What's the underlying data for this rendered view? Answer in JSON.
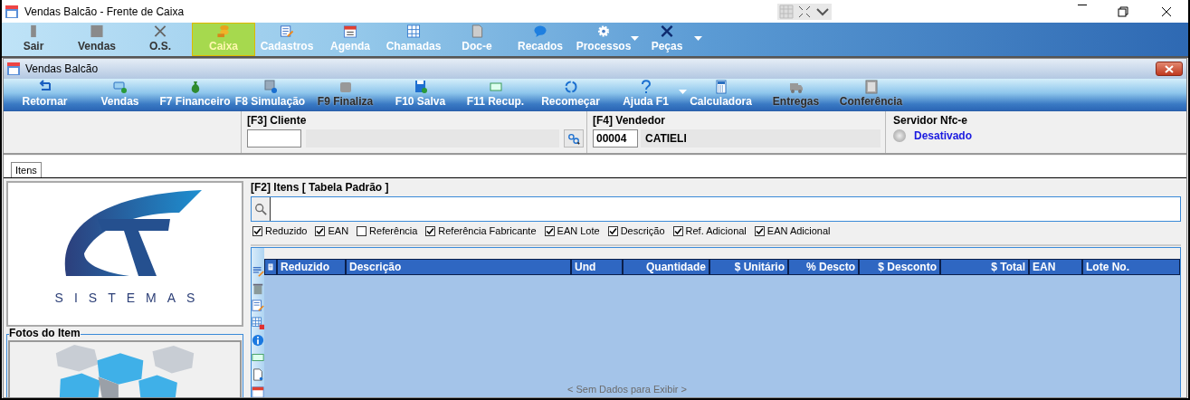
{
  "window": {
    "title": "Vendas Balcão - Frente de Caixa"
  },
  "main_menu": [
    {
      "label": "Sair",
      "selected": false,
      "has_menu": false
    },
    {
      "label": "Vendas",
      "selected": false,
      "has_menu": false
    },
    {
      "label": "O.S.",
      "selected": false,
      "has_menu": false
    },
    {
      "label": "Caixa",
      "selected": true,
      "has_menu": false
    },
    {
      "label": "Cadastros",
      "selected": false,
      "has_menu": false
    },
    {
      "label": "Agenda",
      "selected": false,
      "has_menu": false
    },
    {
      "label": "Chamadas",
      "selected": false,
      "has_menu": false
    },
    {
      "label": "Doc-e",
      "selected": false,
      "has_menu": false
    },
    {
      "label": "Recados",
      "selected": false,
      "has_menu": false
    },
    {
      "label": "Processos",
      "selected": false,
      "has_menu": true
    },
    {
      "label": "Peças",
      "selected": false,
      "has_menu": true
    }
  ],
  "child_window": {
    "title": "Vendas Balcão",
    "toolbar": [
      {
        "label": "Retornar",
        "disabled": false,
        "has_menu": false
      },
      {
        "label": "Vendas",
        "disabled": false,
        "has_menu": false
      },
      {
        "label": "F7 Financeiro",
        "disabled": false,
        "has_menu": false
      },
      {
        "label": "F8 Simulação",
        "disabled": false,
        "has_menu": false
      },
      {
        "label": "F9 Finaliza",
        "disabled": true,
        "has_menu": false
      },
      {
        "label": "F10 Salva",
        "disabled": false,
        "has_menu": false
      },
      {
        "label": "F11 Recup.",
        "disabled": false,
        "has_menu": false
      },
      {
        "label": "Recomeçar",
        "disabled": false,
        "has_menu": false
      },
      {
        "label": "Ajuda F1",
        "disabled": false,
        "has_menu": true
      },
      {
        "label": "Calculadora",
        "disabled": false,
        "has_menu": false
      },
      {
        "label": "Entregas",
        "disabled": true,
        "has_menu": false
      },
      {
        "label": "Conferência",
        "disabled": true,
        "has_menu": false
      }
    ],
    "cliente": {
      "label": "[F3] Cliente"
    },
    "vendedor": {
      "label": "[F4] Vendedor",
      "code": "00004",
      "name": "CATIELI"
    },
    "servidor": {
      "label": "Servidor Nfc-e",
      "status": "Desativado",
      "on": false
    },
    "tabs": [
      {
        "label": "Itens",
        "selected": true
      }
    ],
    "logo": {
      "text": "SISTEMAS"
    },
    "photos": {
      "title": "Fotos do Item"
    },
    "items": {
      "title": "[F2] Itens [ Tabela Padrão ]",
      "filters": [
        {
          "label": "Reduzido",
          "checked": true
        },
        {
          "label": "EAN",
          "checked": true
        },
        {
          "label": "Referência",
          "checked": false
        },
        {
          "label": "Referência Fabricante",
          "checked": true
        },
        {
          "label": "EAN Lote",
          "checked": true
        },
        {
          "label": "Descrição",
          "checked": true
        },
        {
          "label": "Ref. Adicional",
          "checked": true
        },
        {
          "label": "EAN Adicional",
          "checked": true
        }
      ],
      "table": {
        "columns": [
          {
            "label": "Reduzido"
          },
          {
            "label": "Descrição"
          },
          {
            "label": "Und"
          },
          {
            "label": "Quantidade"
          },
          {
            "label": "$ Unitário"
          },
          {
            "label": "% Descto"
          },
          {
            "label": "$ Desconto"
          },
          {
            "label": "$ Total"
          },
          {
            "label": "EAN"
          },
          {
            "label": "Lote No."
          }
        ],
        "empty_message": "< Sem Dados para Exibir >"
      }
    }
  }
}
